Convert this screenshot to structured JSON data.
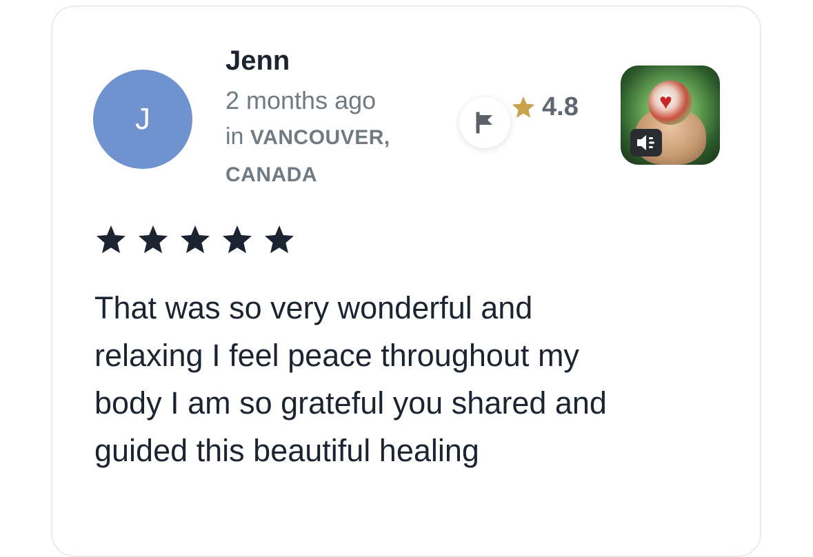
{
  "review": {
    "avatar_initial": "J",
    "reviewer_name": "Jenn",
    "time_ago": "2 months ago",
    "location_prefix": "in",
    "location_city": "VANCOUVER,",
    "location_country": "CANADA",
    "content_rating": "4.8",
    "stars_given": 5,
    "stars_max": 5,
    "text": "That was so very wonderful and relaxing I feel peace throughout my body I am so grateful you shared and guided this beautiful healing"
  },
  "icons": {
    "flag": "flag-icon",
    "rating_star": "star-icon",
    "review_star": "star-icon",
    "sound": "speaker-icon"
  },
  "colors": {
    "avatar_bg": "#7093cf",
    "rating_star": "#c9a24e",
    "review_star": "#1c2431",
    "text_primary": "#1c2431",
    "text_secondary": "#707a83"
  }
}
